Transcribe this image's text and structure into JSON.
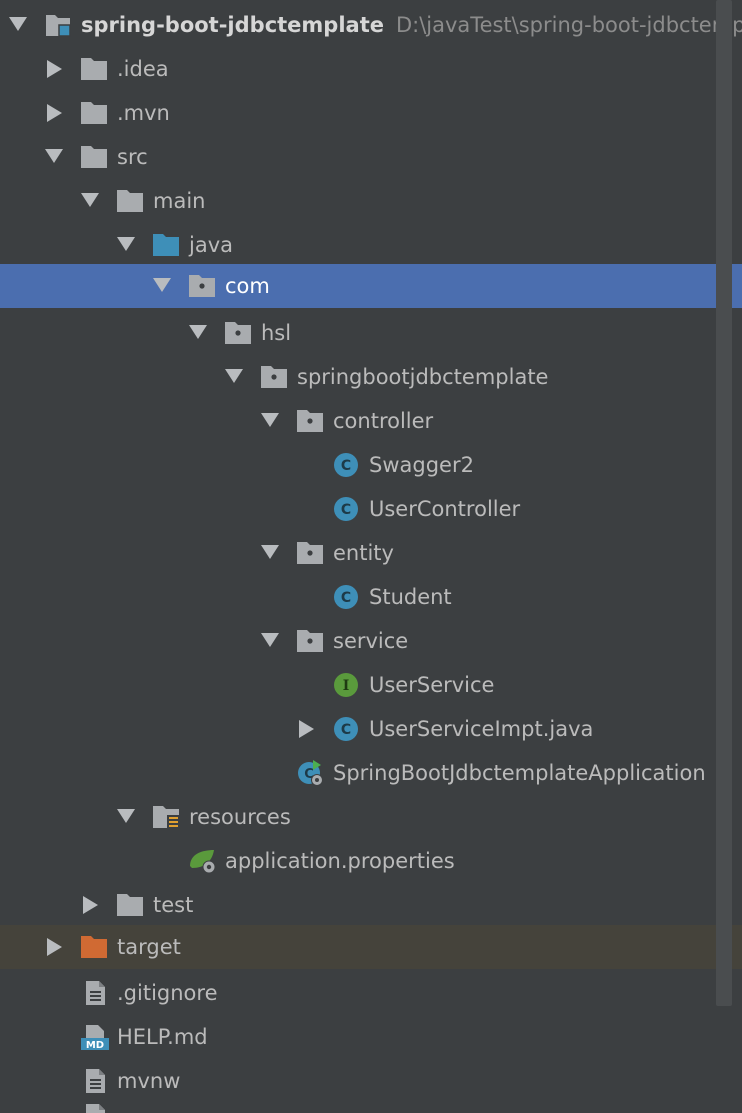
{
  "colors": {
    "background": "#3c3f41",
    "selection": "#4b6eaf",
    "excluded_row": "#45433b",
    "folder_gray": "#a9acaf",
    "folder_blue": "#3e8fb8",
    "folder_orange": "#d06a33",
    "class_badge": "#3e8fb8",
    "interface_badge": "#5a9a3c"
  },
  "project": {
    "name": "spring-boot-jdbctemplate",
    "path": "D:\\javaTest\\spring-boot-jdbctemplate"
  },
  "items": [
    {
      "label": ".idea",
      "icon": "folder-icon",
      "arrow": "collapsed"
    },
    {
      "label": ".mvn",
      "icon": "folder-icon",
      "arrow": "collapsed"
    },
    {
      "label": "src",
      "icon": "folder-icon",
      "arrow": "expanded"
    },
    {
      "label": "main",
      "icon": "folder-icon",
      "arrow": "expanded"
    },
    {
      "label": "java",
      "icon": "source-folder-icon",
      "arrow": "expanded"
    },
    {
      "label": "com",
      "icon": "package-icon",
      "arrow": "expanded",
      "selected": true
    },
    {
      "label": "hsl",
      "icon": "package-icon",
      "arrow": "expanded"
    },
    {
      "label": "springbootjdbctemplate",
      "icon": "package-icon",
      "arrow": "expanded"
    },
    {
      "label": "controller",
      "icon": "package-icon",
      "arrow": "expanded"
    },
    {
      "label": "Swagger2",
      "icon": "class-icon"
    },
    {
      "label": "UserController",
      "icon": "class-icon"
    },
    {
      "label": "entity",
      "icon": "package-icon",
      "arrow": "expanded"
    },
    {
      "label": "Student",
      "icon": "class-icon"
    },
    {
      "label": "service",
      "icon": "package-icon",
      "arrow": "expanded"
    },
    {
      "label": "UserService",
      "icon": "interface-icon"
    },
    {
      "label": "UserServiceImpt.java",
      "icon": "class-icon",
      "arrow": "collapsed"
    },
    {
      "label": "SpringBootJdbctemplateApplication",
      "icon": "spring-boot-class-icon"
    },
    {
      "label": "resources",
      "icon": "resources-folder-icon",
      "arrow": "expanded"
    },
    {
      "label": "application.properties",
      "icon": "spring-properties-icon"
    },
    {
      "label": "test",
      "icon": "folder-icon",
      "arrow": "collapsed"
    },
    {
      "label": "target",
      "icon": "excluded-folder-icon",
      "arrow": "collapsed"
    },
    {
      "label": ".gitignore",
      "icon": "text-file-icon"
    },
    {
      "label": "HELP.md",
      "icon": "markdown-file-icon",
      "badge": "MD"
    },
    {
      "label": "mvnw",
      "icon": "text-file-icon"
    }
  ]
}
